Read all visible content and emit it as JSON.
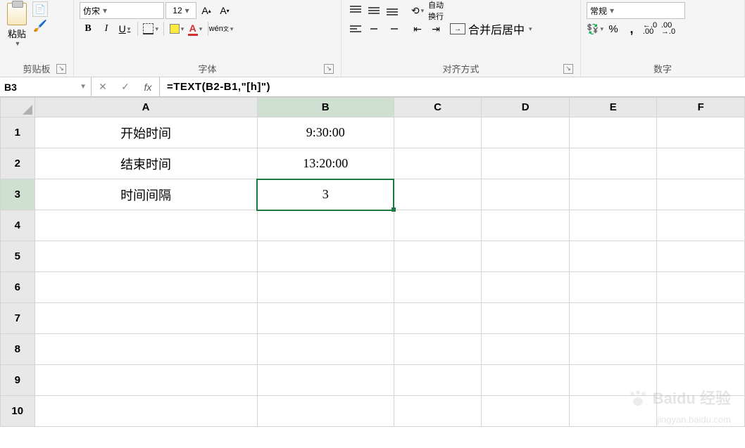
{
  "ribbon": {
    "clipboard": {
      "paste": "粘贴",
      "label": "剪贴板"
    },
    "font": {
      "name": "仿宋",
      "size": "12",
      "bold": "B",
      "italic": "I",
      "underline": "U",
      "wen": "wén",
      "label": "字体"
    },
    "align": {
      "merge": "合并后居中",
      "label": "对齐方式"
    },
    "number": {
      "format": "常规",
      "pct": "%",
      "comma": ",",
      "dec_inc": ".0\n.00",
      "dec_dec": ".00\n.0",
      "label": "数字"
    }
  },
  "nameBox": "B3",
  "formula": "=TEXT(B2-B1,\"[h]\")",
  "columns": [
    "A",
    "B",
    "C",
    "D",
    "E",
    "F"
  ],
  "rowNums": [
    "1",
    "2",
    "3",
    "4",
    "5",
    "6",
    "7",
    "8",
    "9",
    "10"
  ],
  "cells": {
    "A1": "开始时间",
    "B1": "9:30:00",
    "A2": "结束时间",
    "B2": "13:20:00",
    "A3": "时间间隔",
    "B3": "3"
  },
  "selected": "B3",
  "watermark": {
    "brand": "Baidu",
    "exp": "经验",
    "url": "jingyan.baidu.com"
  },
  "colWidths": {
    "row": 50,
    "A": 330,
    "B": 200,
    "C": 130,
    "D": 130,
    "E": 130,
    "F": 130
  }
}
